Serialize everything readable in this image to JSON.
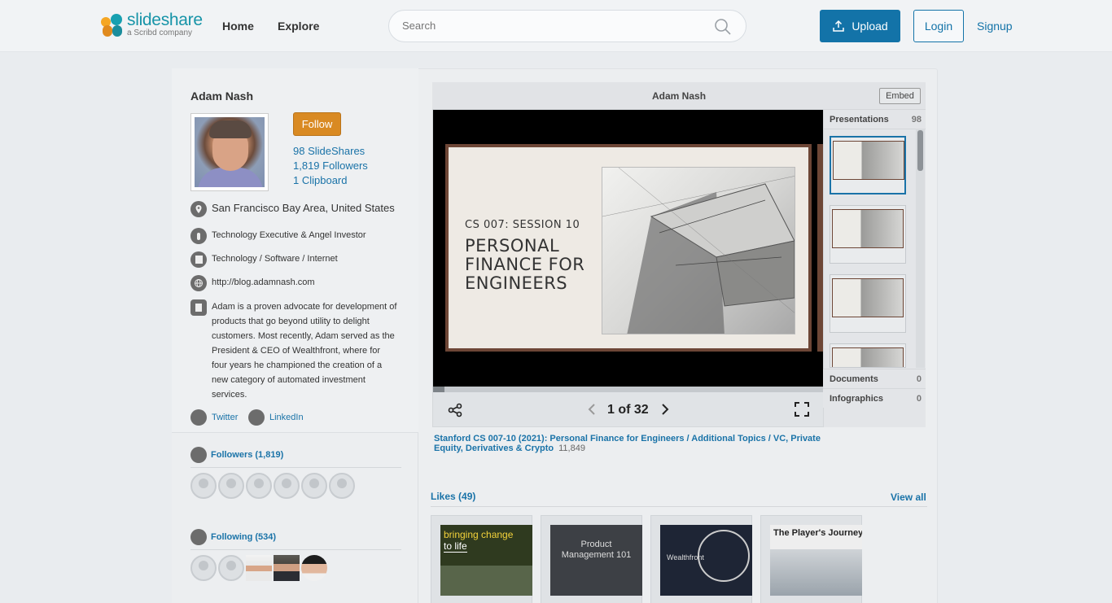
{
  "header": {
    "logo_name": "slideshare",
    "logo_sub": "a Scribd company",
    "nav": [
      "Home",
      "Explore"
    ],
    "search_placeholder": "Search",
    "upload_label": "Upload",
    "login_label": "Login",
    "signup_label": "Signup"
  },
  "profile": {
    "name": "Adam Nash",
    "follow_label": "Follow",
    "stats": [
      "98 SlideShares",
      "1,819 Followers",
      "1 Clipboard"
    ],
    "location": "San Francisco Bay Area, United States",
    "title": "Technology Executive & Angel Investor",
    "industry": "Technology / Software / Internet",
    "website": "http://blog.adamnash.com",
    "bio": "Adam is a proven advocate for development of products that go beyond utility to delight customers. Most recently, Adam served as the President & CEO of Wealthfront, where for four years he championed the creation of a new category of automated investment services.",
    "twitter_label": "Twitter",
    "linkedin_label": "LinkedIn",
    "followers_label": "Followers (1,819)",
    "following_label": "Following (534)"
  },
  "player": {
    "header_title": "Adam Nash",
    "embed_label": "Embed",
    "slide_kicker": "CS 007: SESSION 10",
    "slide_title_1": "PERSONAL",
    "slide_title_2": "FINANCE FOR",
    "slide_title_3": "ENGINEERS",
    "counter": "1 of 32",
    "progress": 0.03,
    "sidebar": {
      "presentations_label": "Presentations",
      "presentations_count": "98",
      "documents_label": "Documents",
      "documents_count": "0",
      "infographics_label": "Infographics",
      "infographics_count": "0"
    }
  },
  "document": {
    "title": "Stanford CS 007-10 (2021): Personal Finance for Engineers / Additional Topics / VC, Private Equity, Derivatives & Crypto",
    "views": "11,849"
  },
  "likes": {
    "title": "Likes (49)",
    "view_all": "View all",
    "cards": [
      {
        "line1": "bringing change",
        "line2": "to life"
      },
      {
        "line1": "Product",
        "line2": "Management 101"
      },
      {
        "line1": "Wealthfront",
        "line2": ""
      },
      {
        "line1": "The Player's Journey",
        "line2": ""
      }
    ]
  },
  "colors": {
    "accent": "#1a73a8",
    "follow": "#d98a23",
    "upload": "#1373a8"
  }
}
